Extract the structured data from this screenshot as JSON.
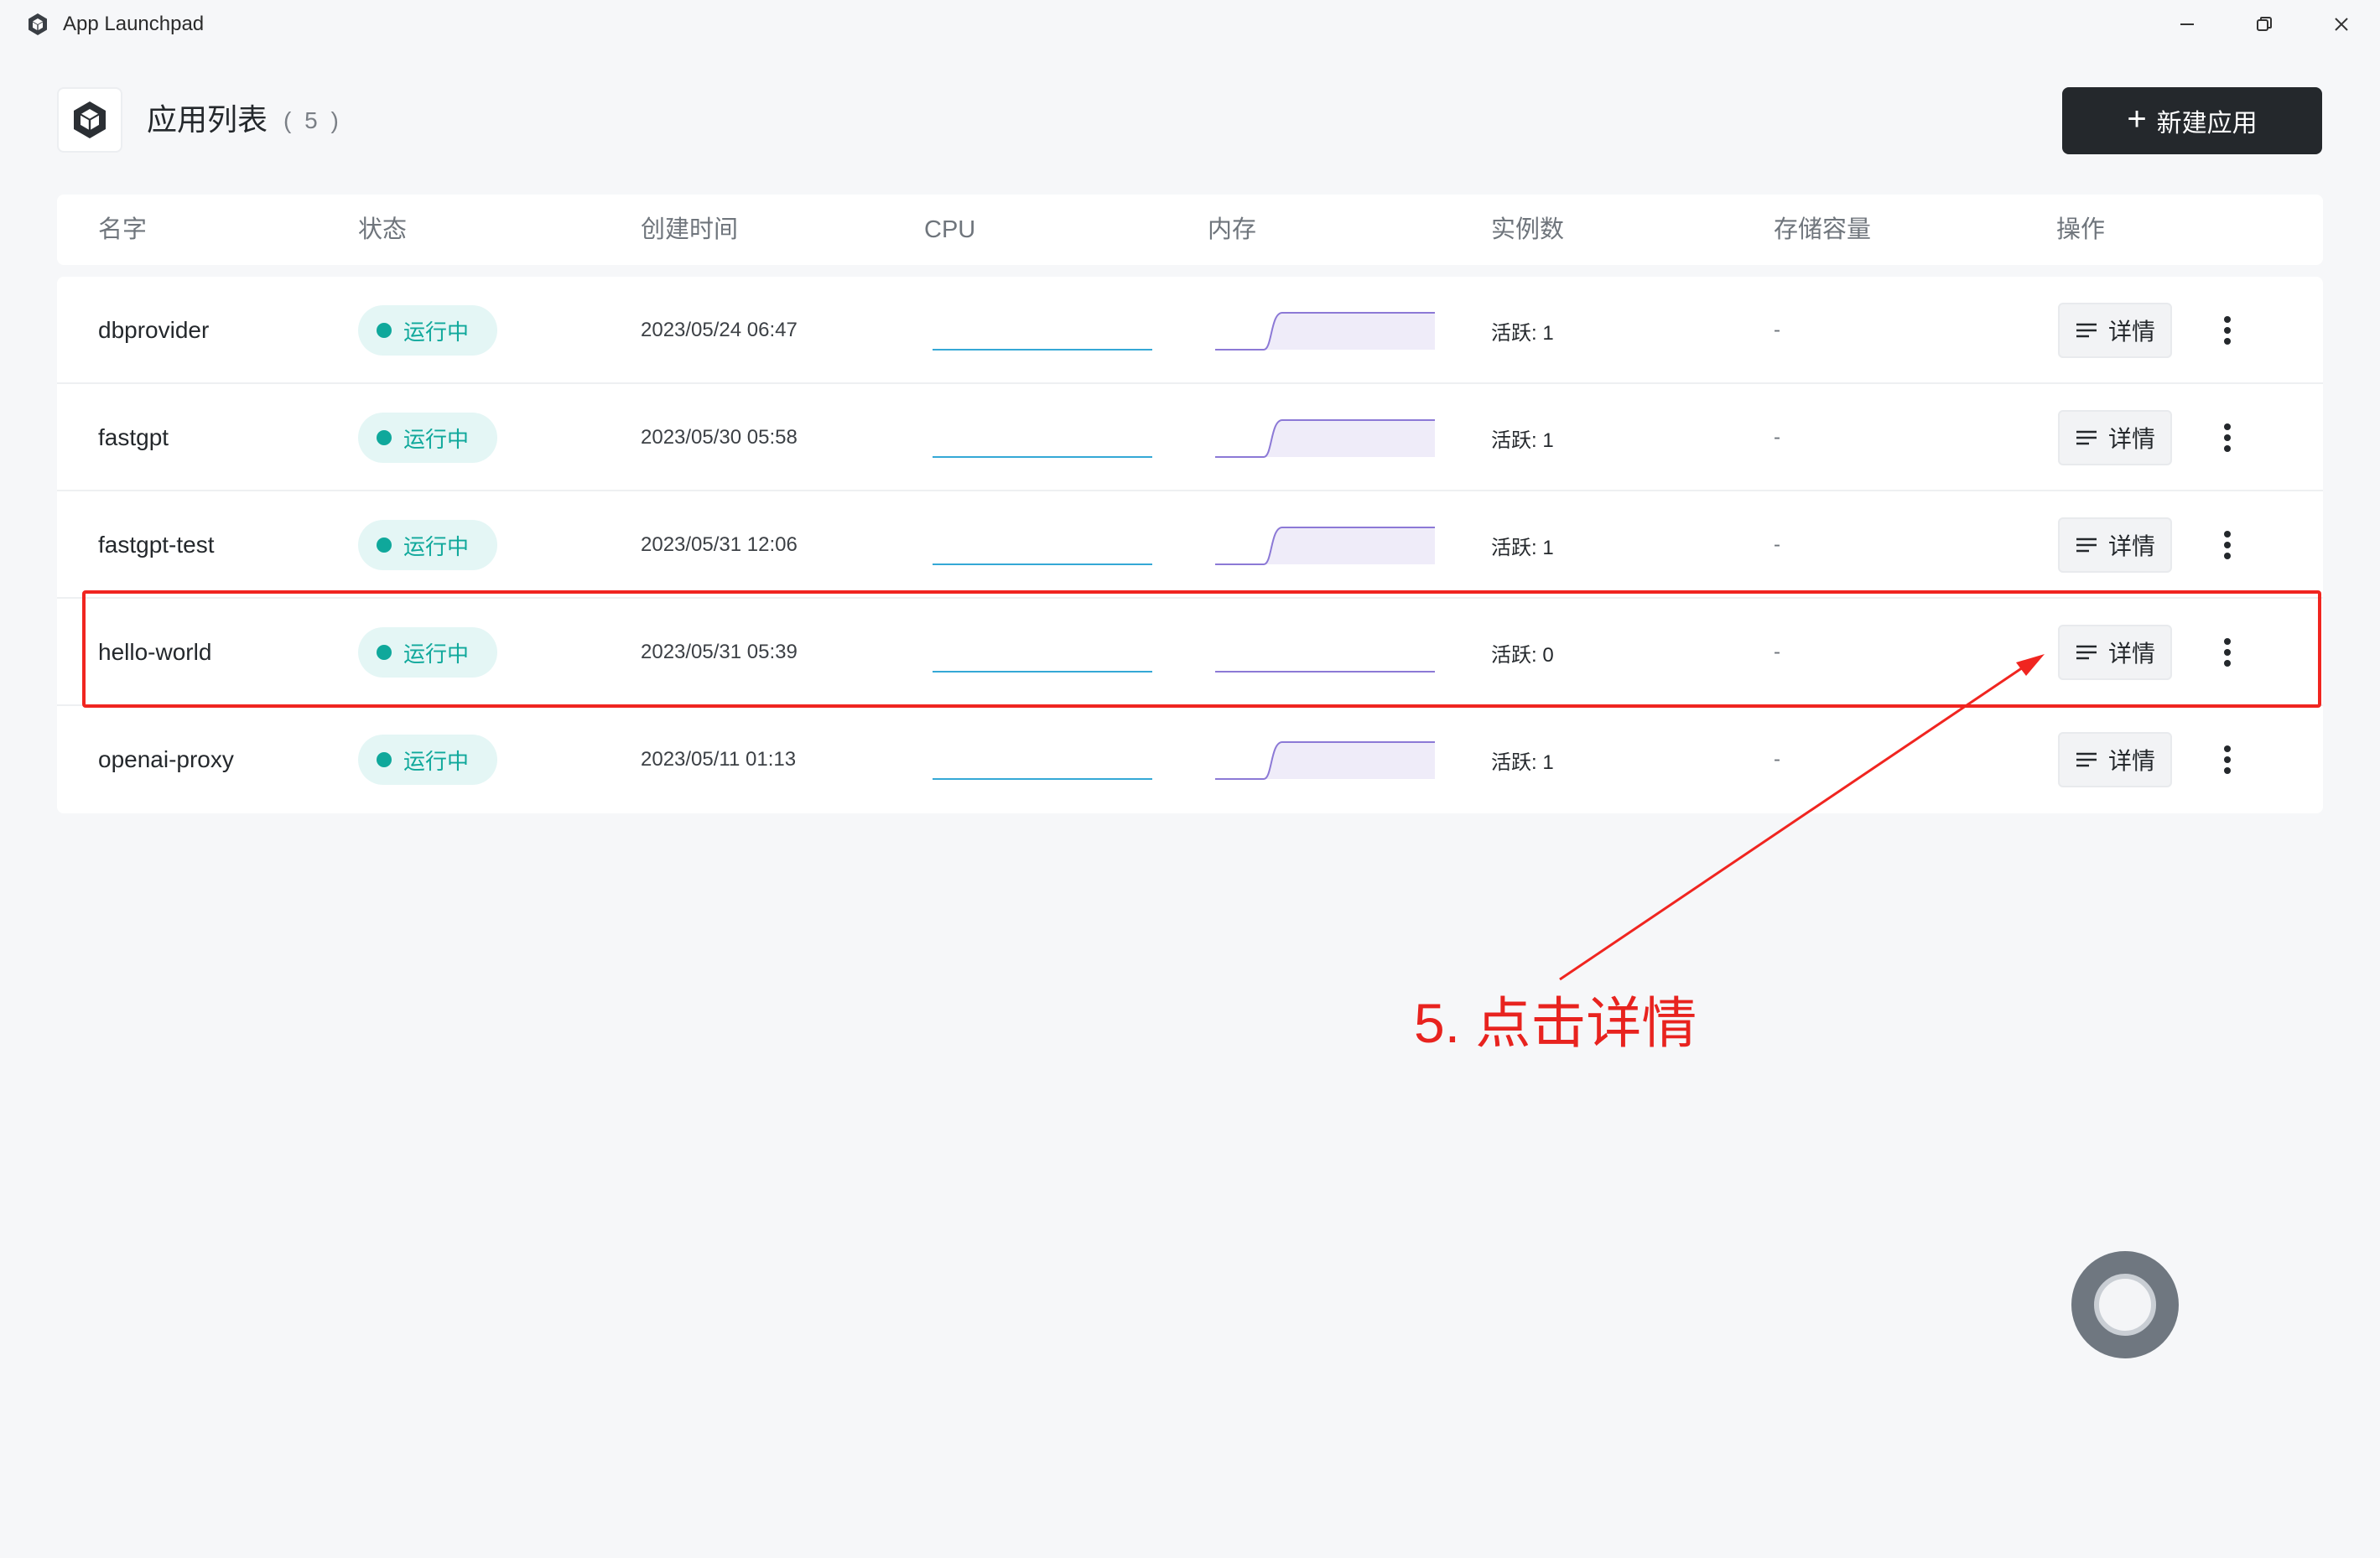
{
  "window": {
    "title": "App Launchpad"
  },
  "header": {
    "title": "应用列表",
    "count": "( 5 )",
    "new_app_label": "新建应用"
  },
  "table": {
    "columns": [
      "名字",
      "状态",
      "创建时间",
      "CPU",
      "内存",
      "实例数",
      "存储容量",
      "操作"
    ],
    "rows": [
      {
        "name": "dbprovider",
        "status": "运行中",
        "created": "2023/05/24 06:47",
        "instances": "活跃: 1",
        "storage": "-",
        "memory_level": 1,
        "detail_label": "详情"
      },
      {
        "name": "fastgpt",
        "status": "运行中",
        "created": "2023/05/30 05:58",
        "instances": "活跃: 1",
        "storage": "-",
        "memory_level": 1,
        "detail_label": "详情"
      },
      {
        "name": "fastgpt-test",
        "status": "运行中",
        "created": "2023/05/31 12:06",
        "instances": "活跃: 1",
        "storage": "-",
        "memory_level": 1,
        "detail_label": "详情"
      },
      {
        "name": "hello-world",
        "status": "运行中",
        "created": "2023/05/31 05:39",
        "instances": "活跃: 0",
        "storage": "-",
        "memory_level": 0,
        "detail_label": "详情"
      },
      {
        "name": "openai-proxy",
        "status": "运行中",
        "created": "2023/05/11 01:13",
        "instances": "活跃: 1",
        "storage": "-",
        "memory_level": 1,
        "detail_label": "详情"
      }
    ]
  },
  "annotation": {
    "text": "5. 点击详情"
  },
  "colors": {
    "status_running": "#0fa89b",
    "cpu_line": "#35a8d6",
    "memory_line": "#8c79d6",
    "annotation_red": "#f02520",
    "primary_button": "#24282c"
  },
  "icons": {
    "app": "hexagon-cube-icon",
    "minimize": "minimize-icon",
    "maximize": "restore-icon",
    "close": "close-icon",
    "detail": "list-lines-icon",
    "more": "vertical-dots-icon",
    "new": "plus-icon"
  }
}
